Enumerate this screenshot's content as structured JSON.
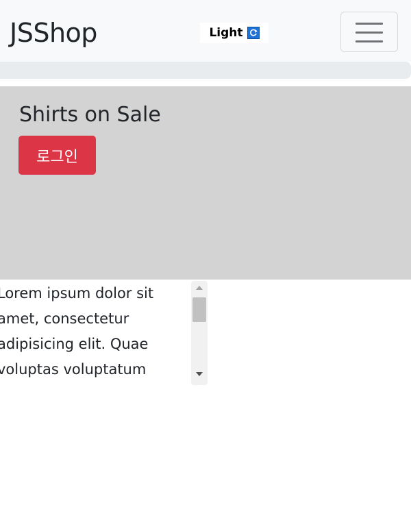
{
  "navbar": {
    "brand": "JSShop",
    "theme_toggle": {
      "label": "Light",
      "icon": "refresh-icon",
      "icon_color": "#1e73d8"
    },
    "toggler_icon": "hamburger-menu-icon"
  },
  "hero": {
    "background": "#d3d3d3",
    "title": "Shirts on Sale",
    "login_button": {
      "label": "로그인",
      "color": "#dc3545"
    }
  },
  "content": {
    "text": "Lorem ipsum dolor sit amet, consectetur adipisicing elit. Quae voluptas voluptatum"
  }
}
